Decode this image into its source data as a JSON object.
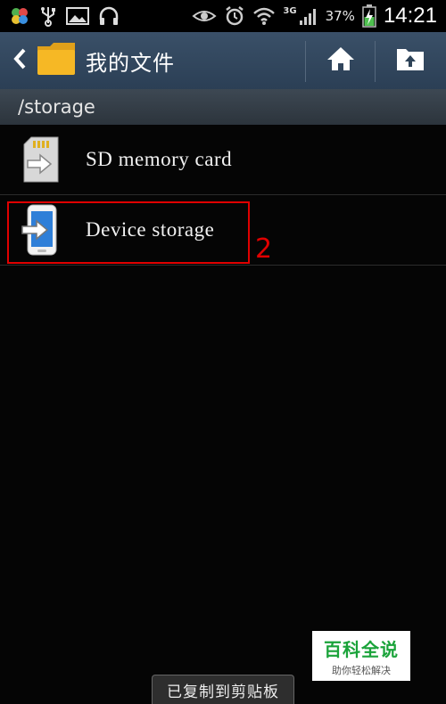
{
  "status_bar": {
    "battery_percent": "37%",
    "network_type": "3G",
    "time": "14:21",
    "icons": [
      "clover-app-icon",
      "usb-icon",
      "image-icon",
      "headphones-icon",
      "eye-icon",
      "alarm-icon",
      "wifi-icon",
      "signal-icon",
      "battery-charging-icon"
    ]
  },
  "action_bar": {
    "title": "我的文件",
    "back_icon": "chevron-left-icon",
    "folder_icon": "folder-icon",
    "home_icon": "home-icon",
    "up_icon": "folder-up-icon"
  },
  "path": {
    "current": "/storage"
  },
  "storage_list": [
    {
      "label": "SD memory card",
      "icon": "sd-card-icon"
    },
    {
      "label": "Device storage",
      "icon": "phone-storage-icon"
    }
  ],
  "annotation": {
    "number": "2",
    "color": "#e00000"
  },
  "watermark": {
    "brand": "百科全说",
    "tagline": "助你轻松解决"
  },
  "toast": {
    "message": "已复制到剪贴板"
  },
  "colors": {
    "action_bar": "#34495f",
    "path_bar": "#353e47",
    "background": "#050505",
    "folder": "#f6b825",
    "watermark_green": "#1aa33a"
  }
}
